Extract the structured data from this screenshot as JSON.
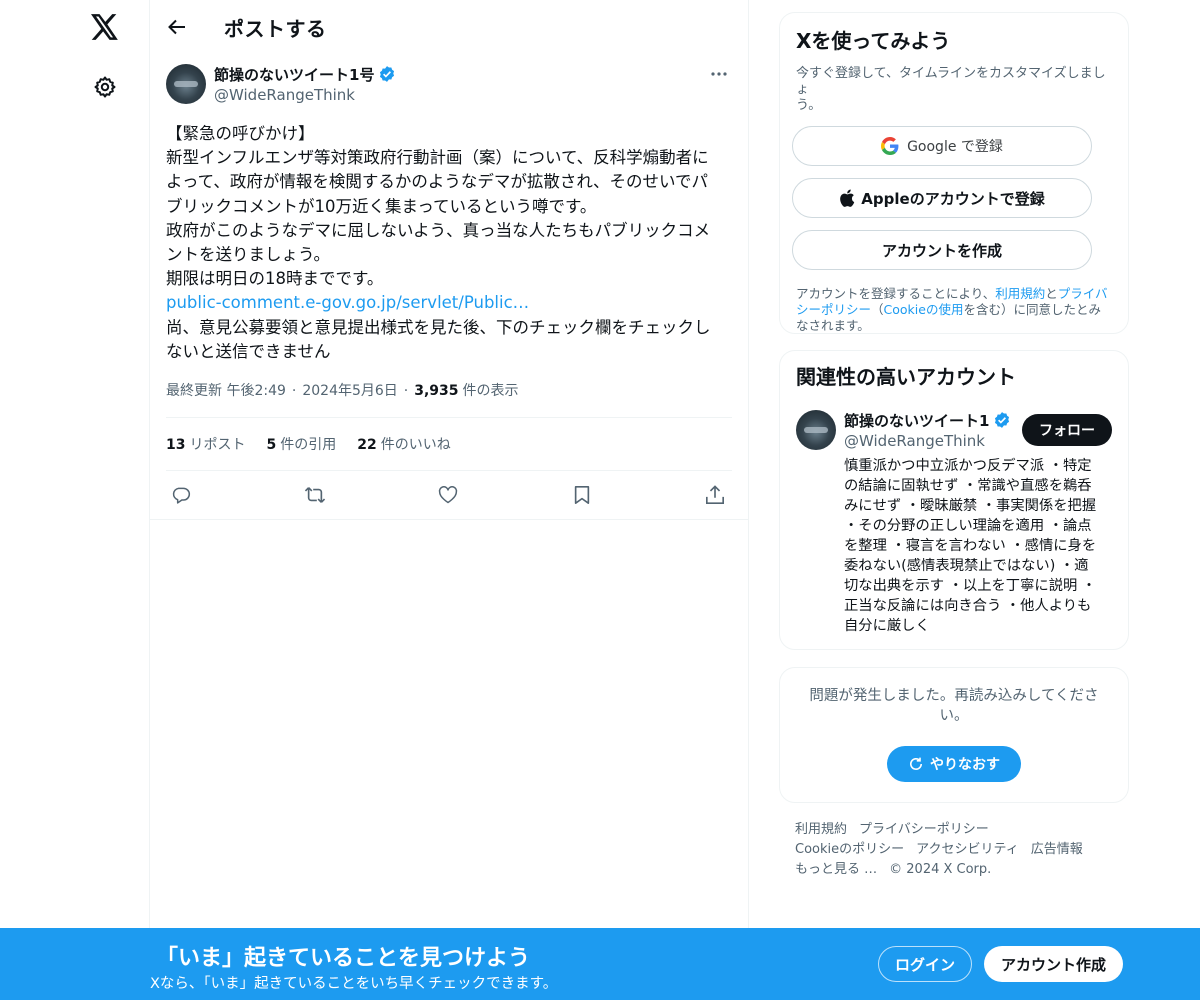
{
  "header": {
    "title": "ポストする"
  },
  "post": {
    "author_name": "節操のないツイート1号",
    "author_handle": "@WideRangeThink",
    "lines": [
      "【緊急の呼びかけ】",
      "新型インフルエンザ等対策政府行動計画（案）について、反科学煽動者に",
      "よって、政府が情報を検閲するかのようなデマが拡散され、そのせいでパ",
      "ブリックコメントが10万近く集まっているという噂です。",
      "政府がこのようなデマに屈しないよう、真っ当な人たちもパブリックコメ",
      "ントを送りましょう。",
      "期限は明日の18時までです。"
    ],
    "link": "public-comment.e-gov.go.jp/servlet/Public…",
    "lines_after": [
      "尚、意見公募要領と意見提出様式を見た後、下のチェック欄をチェックし",
      "ないと送信できません"
    ],
    "meta": {
      "updated_label": "最終更新 午後2:49",
      "date": "2024年5月6日",
      "views_count": "3,935",
      "views_label": "件の表示"
    },
    "stats": {
      "reposts_count": "13",
      "reposts_label": "リポスト",
      "quotes_count": "5",
      "quotes_label": "件の引用",
      "likes_count": "22",
      "likes_label": "件のいいね"
    }
  },
  "signup": {
    "title": "Xを使ってみよう",
    "subtitle_1": "今すぐ登録して、タイムラインをカスタマイズしましょ",
    "subtitle_2": "う。",
    "google_label": "Google で登録",
    "apple_label": "Appleのアカウントで登録",
    "create_label": "アカウントを作成",
    "legal_1a": "アカウントを登録することにより、",
    "legal_1b": "利用規約",
    "legal_1c": "と",
    "legal_1d": "プライバ",
    "legal_2a": "シーポリシー",
    "legal_2b": "（",
    "legal_2c": "Cookieの使用",
    "legal_2d": "を含む）に同意したとみ",
    "legal_3": "なされます。"
  },
  "related": {
    "title": "関連性の高いアカウント",
    "name": "節操のないツイート1",
    "handle": "@WideRangeThink",
    "follow_label": "フォロー",
    "bio_lines": [
      "慎重派かつ中立派かつ反デマ派 ・特定",
      "の結論に固執せず ・常識や直感を鵜呑",
      "みにせず ・曖昧厳禁 ・事実関係を把握",
      "・その分野の正しい理論を適用 ・論点",
      "を整理 ・寝言を言わない ・感情に身を",
      "委ねない(感情表現禁止ではない) ・適",
      "切な出典を示す ・以上を丁寧に説明 ・",
      "正当な反論には向き合う ・他人よりも",
      "自分に厳しく"
    ]
  },
  "error": {
    "text_1": "問題が発生しました。再読み込みしてくださ",
    "text_2": "い。",
    "retry_label": "やりなおす"
  },
  "footer": {
    "terms": "利用規約",
    "privacy": "プライバシーポリシー",
    "cookie": "Cookieのポリシー",
    "accessibility": "アクセシビリティ",
    "ads": "広告情報",
    "more": "もっと見る …",
    "copyright": "© 2024 X Corp."
  },
  "banner": {
    "title": "「いま」起きていることを見つけよう",
    "subtitle": "Xなら、「いま」起きていることをいち早くチェックできます。",
    "login_label": "ログイン",
    "create_label": "アカウント作成"
  },
  "colors": {
    "accent": "#1d9bf0",
    "text": "#0f1419",
    "muted": "#536471"
  }
}
